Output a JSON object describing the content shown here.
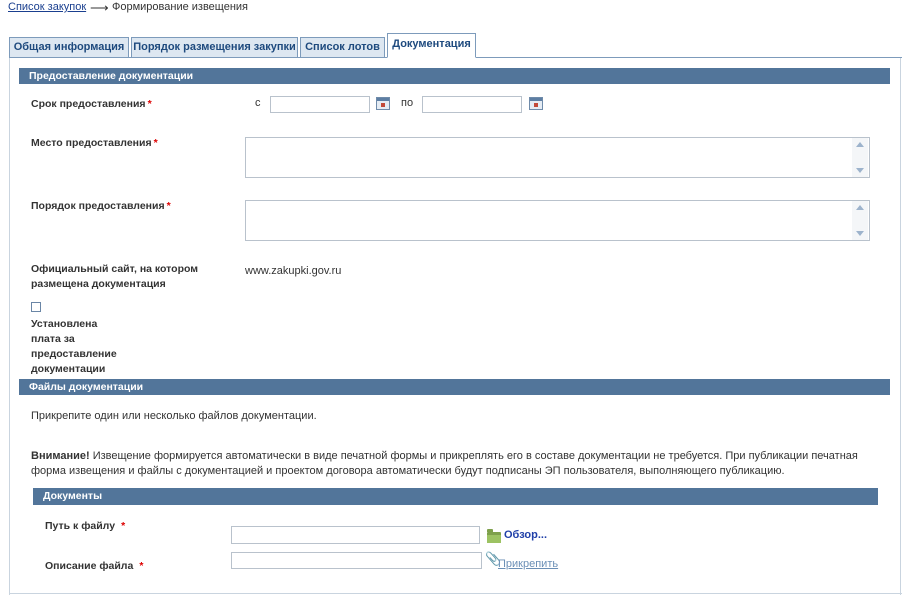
{
  "breadcrumb": {
    "link": "Список закупок",
    "arrow": "⟶",
    "current": "Формирование извещения"
  },
  "tabs": [
    {
      "label": "Общая информация",
      "active": false
    },
    {
      "label": "Порядок размещения закупки",
      "active": false
    },
    {
      "label": "Список лотов",
      "active": false
    },
    {
      "label": "Документация",
      "active": true
    }
  ],
  "provision": {
    "section_title": "Предоставление документации",
    "period_label": "Срок предоставления",
    "from_label": "с",
    "to_label": "по",
    "from_value": "",
    "to_value": "",
    "place_label": "Место предоставления",
    "place_value": "",
    "order_label": "Порядок предоставления",
    "order_value": "",
    "site_label_line1": "Официальный сайт, на котором",
    "site_label_line2": "размещена документация",
    "site_value": "www.zakupki.gov.ru",
    "fee_checked": false,
    "fee_label_lines": [
      "Установлена",
      "плата за",
      "предоставление",
      "документации"
    ]
  },
  "files": {
    "section_title": "Файлы документации",
    "hint": "Прикрепите один или несколько файлов документации.",
    "warning_bold": "Внимание!",
    "warning_line1": " Извещение формируется автоматически в виде печатной формы и прикреплять его в составе документации не требуется. При публикации печатная",
    "warning_line2": "форма извещения и файлы с документацией и проектом договора автоматически будут подписаны ЭП пользователя, выполняющего публикацию.",
    "documents_title": "Документы",
    "path_label": "Путь к файлу",
    "path_value": "",
    "browse_label": "Обзор...",
    "desc_label": "Описание файла",
    "desc_value": "",
    "attach_label": "Прикрепить"
  },
  "required_mark": "*",
  "colors": {
    "section_bar": "#52759a",
    "tab_bg": "#dde7f1",
    "link": "#1a3f8f",
    "required": "#dd0000"
  }
}
